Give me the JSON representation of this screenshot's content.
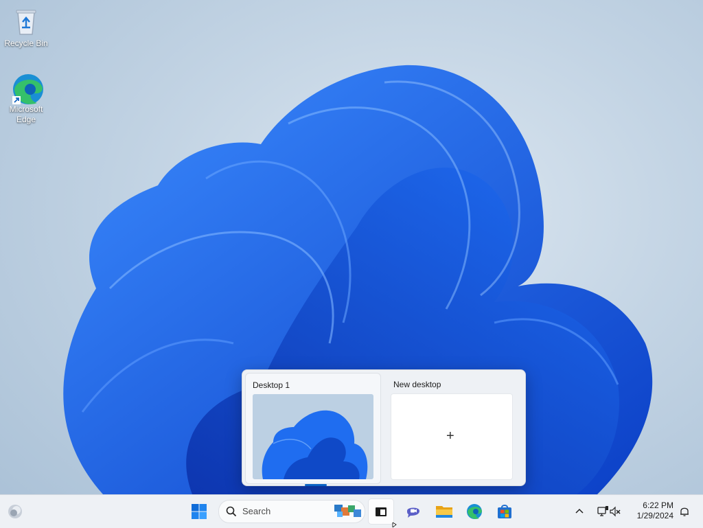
{
  "desktop": {
    "icons": [
      {
        "label": "Recycle Bin",
        "icon": "recycle-bin-icon"
      },
      {
        "label": "Microsoft Edge",
        "icon": "edge-icon"
      }
    ]
  },
  "taskview": {
    "desktops": [
      {
        "title": "Desktop 1",
        "active": true
      },
      {
        "title": "New desktop",
        "action": "+"
      }
    ]
  },
  "taskbar": {
    "search_placeholder": "Search",
    "apps": [
      "start-icon",
      "task-view-icon",
      "teams-chat-icon",
      "file-explorer-icon",
      "edge-icon",
      "store-icon"
    ],
    "time": "6:22 PM",
    "date": "1/29/2024"
  },
  "colors": {
    "accent": "#0b63c4",
    "wallpaper_blue": "#1565e8"
  }
}
